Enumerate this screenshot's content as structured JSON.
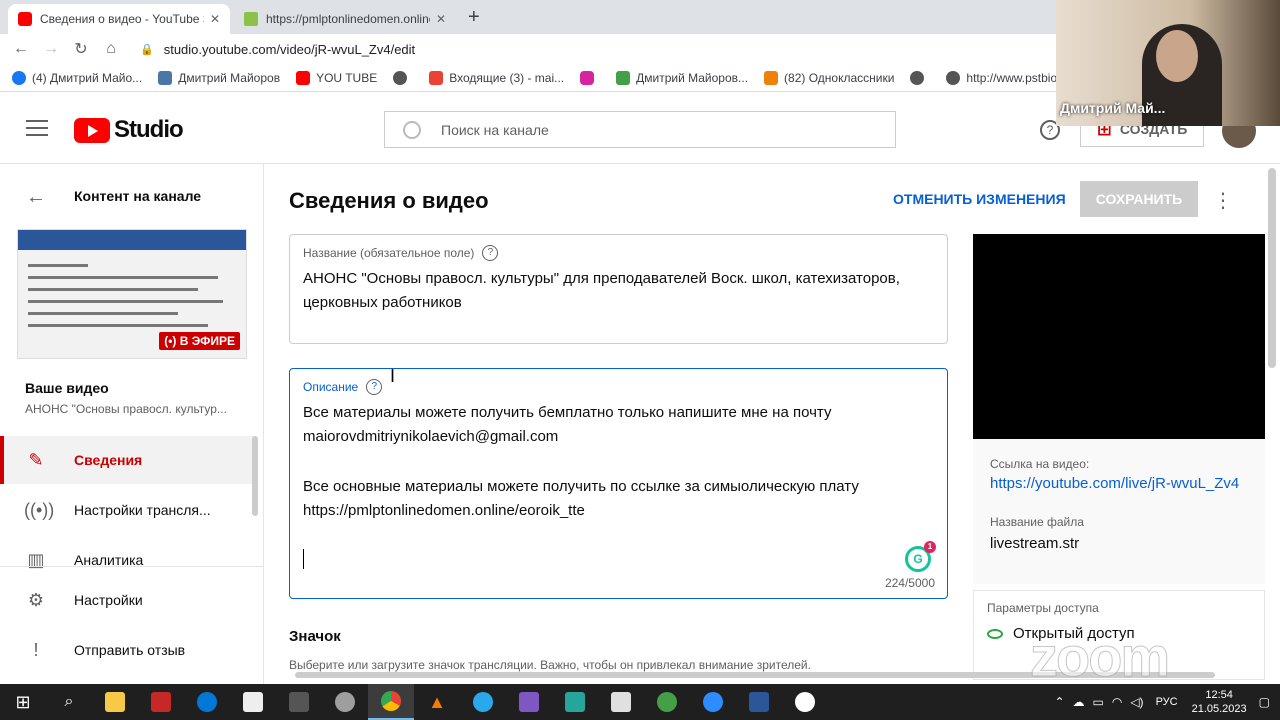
{
  "browser": {
    "tabs": [
      {
        "title": "Сведения о видео - YouTube Studio",
        "active": true
      },
      {
        "title": "https://pmlptonlinedomen.online/",
        "active": false
      }
    ],
    "url": "studio.youtube.com/video/jR-wvuL_Zv4/edit",
    "bookmarks": [
      "(4) Дмитрий Майо...",
      "Дмитрий Майоров",
      "YOU TUBE",
      "",
      "Входящие (3) - mai...",
      "",
      "Дмитрий Майоров...",
      "(82) Одноклассники",
      "",
      "http://www.pstbion..."
    ]
  },
  "header": {
    "logo_text": "Studio",
    "search_placeholder": "Поиск на канале",
    "help": "?",
    "create_label": "СОЗДАТЬ"
  },
  "sidebar": {
    "title": "Контент на канале",
    "live_badge": "(•) В ЭФИРЕ",
    "your_video": "Ваше видео",
    "your_video_title": "АНОНС \"Основы правосл. культур...",
    "items": [
      {
        "label": "Сведения",
        "icon": "pencil-icon"
      },
      {
        "label": "Настройки трансля...",
        "icon": "broadcast-icon"
      },
      {
        "label": "Аналитика",
        "icon": "analytics-icon"
      },
      {
        "label": "Настройки",
        "icon": "gear-icon"
      },
      {
        "label": "Отправить отзыв",
        "icon": "feedback-icon"
      }
    ]
  },
  "main": {
    "page_title": "Сведения о видео",
    "undo_label": "ОТМЕНИТЬ ИЗМЕНЕНИЯ",
    "save_label": "СОХРАНИТЬ",
    "title_field": {
      "label": "Название (обязательное поле)",
      "value": "АНОНС \"Основы правосл. культуры\" для преподавателей Воск. школ, катехизаторов, церковных работников"
    },
    "description_field": {
      "label": "Описание",
      "line1": "Все материалы можете получить бемплатно только напишите мне на почту",
      "line2": "maiorovdmitriynikolaevich@gmail.com",
      "line3": "Все основные материалы можете получить по ссылке за симыолическую плату",
      "line4": "https://pmlptonlinedomen.online/eoroik_tte",
      "counter": "224/5000",
      "grammarly_count": "1"
    },
    "thumbnail_heading": "Значок",
    "thumbnail_sub": "Выберите или загрузите значок трансляции. Важно, чтобы он привлекал внимание зрителей."
  },
  "right_panel": {
    "link_label": "Ссылка на видео:",
    "link_value": "https://youtube.com/live/jR-wvuL_Zv4",
    "file_label": "Название файла",
    "file_value": "livestream.str",
    "access_label": "Параметры доступа",
    "access_value": "Открытый доступ"
  },
  "zoom": {
    "participant_name": "Дмитрий Май...",
    "watermark": "zoom"
  },
  "taskbar": {
    "lang": "РУС",
    "time": "12:54",
    "date": "21.05.2023"
  },
  "colors": {
    "accent_red": "#cc0000",
    "link_blue": "#065fd4",
    "youtube_red": "#ff0000"
  }
}
